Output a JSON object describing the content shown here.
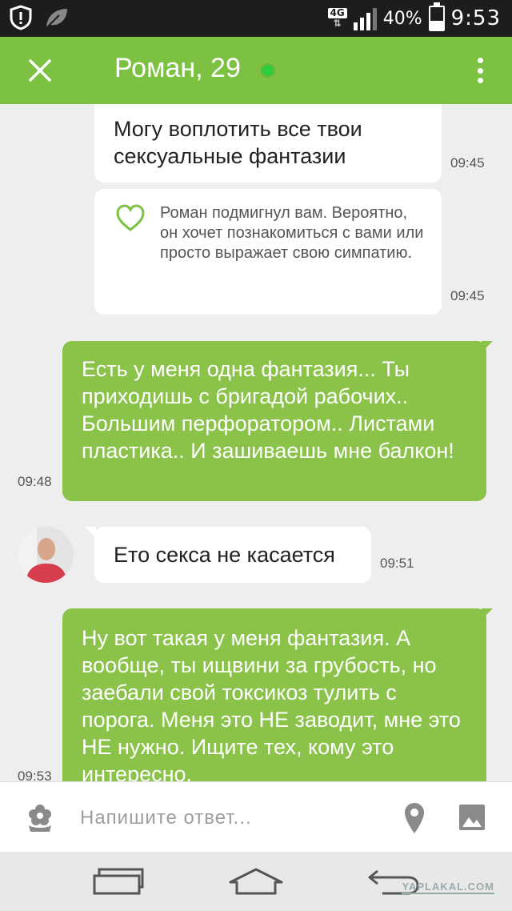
{
  "status_bar": {
    "network_type": "4G",
    "battery_percent": "40%",
    "battery_level": 0.4,
    "time": "9:53",
    "icons": [
      "alert-shield-icon",
      "leaf-icon",
      "signal-icon",
      "battery-icon"
    ]
  },
  "header": {
    "title": "Роман, 29",
    "online": true,
    "online_color": "#2ecc40",
    "accent": "#7cc142"
  },
  "messages": [
    {
      "direction": "incoming",
      "text": "Могу воплотить все твои сексуальные фантазии",
      "time": "09:45"
    },
    {
      "direction": "incoming",
      "type": "wink",
      "text": "Роман подмигнул вам. Вероятно, он хочет познакомиться с вами или просто выражает свою симпатию.",
      "time": "09:45"
    },
    {
      "direction": "outgoing",
      "text": "Есть у меня одна фантазия... Ты приходишь с бригадой рабочих.. Большим перфоратором.. Листами пластика.. И зашиваешь мне балкон!",
      "time": "09:48"
    },
    {
      "direction": "incoming",
      "text": "Ето секса не касается",
      "time": "09:51"
    },
    {
      "direction": "outgoing",
      "text": "Ну вот такая у меня фантазия. А вообще, ты ищвини за грубость, но заебали свой токсикоз тулить с порога. Меня это НЕ заводит, мне это НЕ нужно. Ищите тех, кому это интересно.",
      "time": "09:53"
    }
  ],
  "input_bar": {
    "placeholder": "Напишите ответ...",
    "value": ""
  },
  "watermark": "YAPLAKAL.COM",
  "colors": {
    "outgoing_bubble": "#8bc34a",
    "incoming_bubble": "#ffffff",
    "chat_background": "#eeeeee"
  }
}
